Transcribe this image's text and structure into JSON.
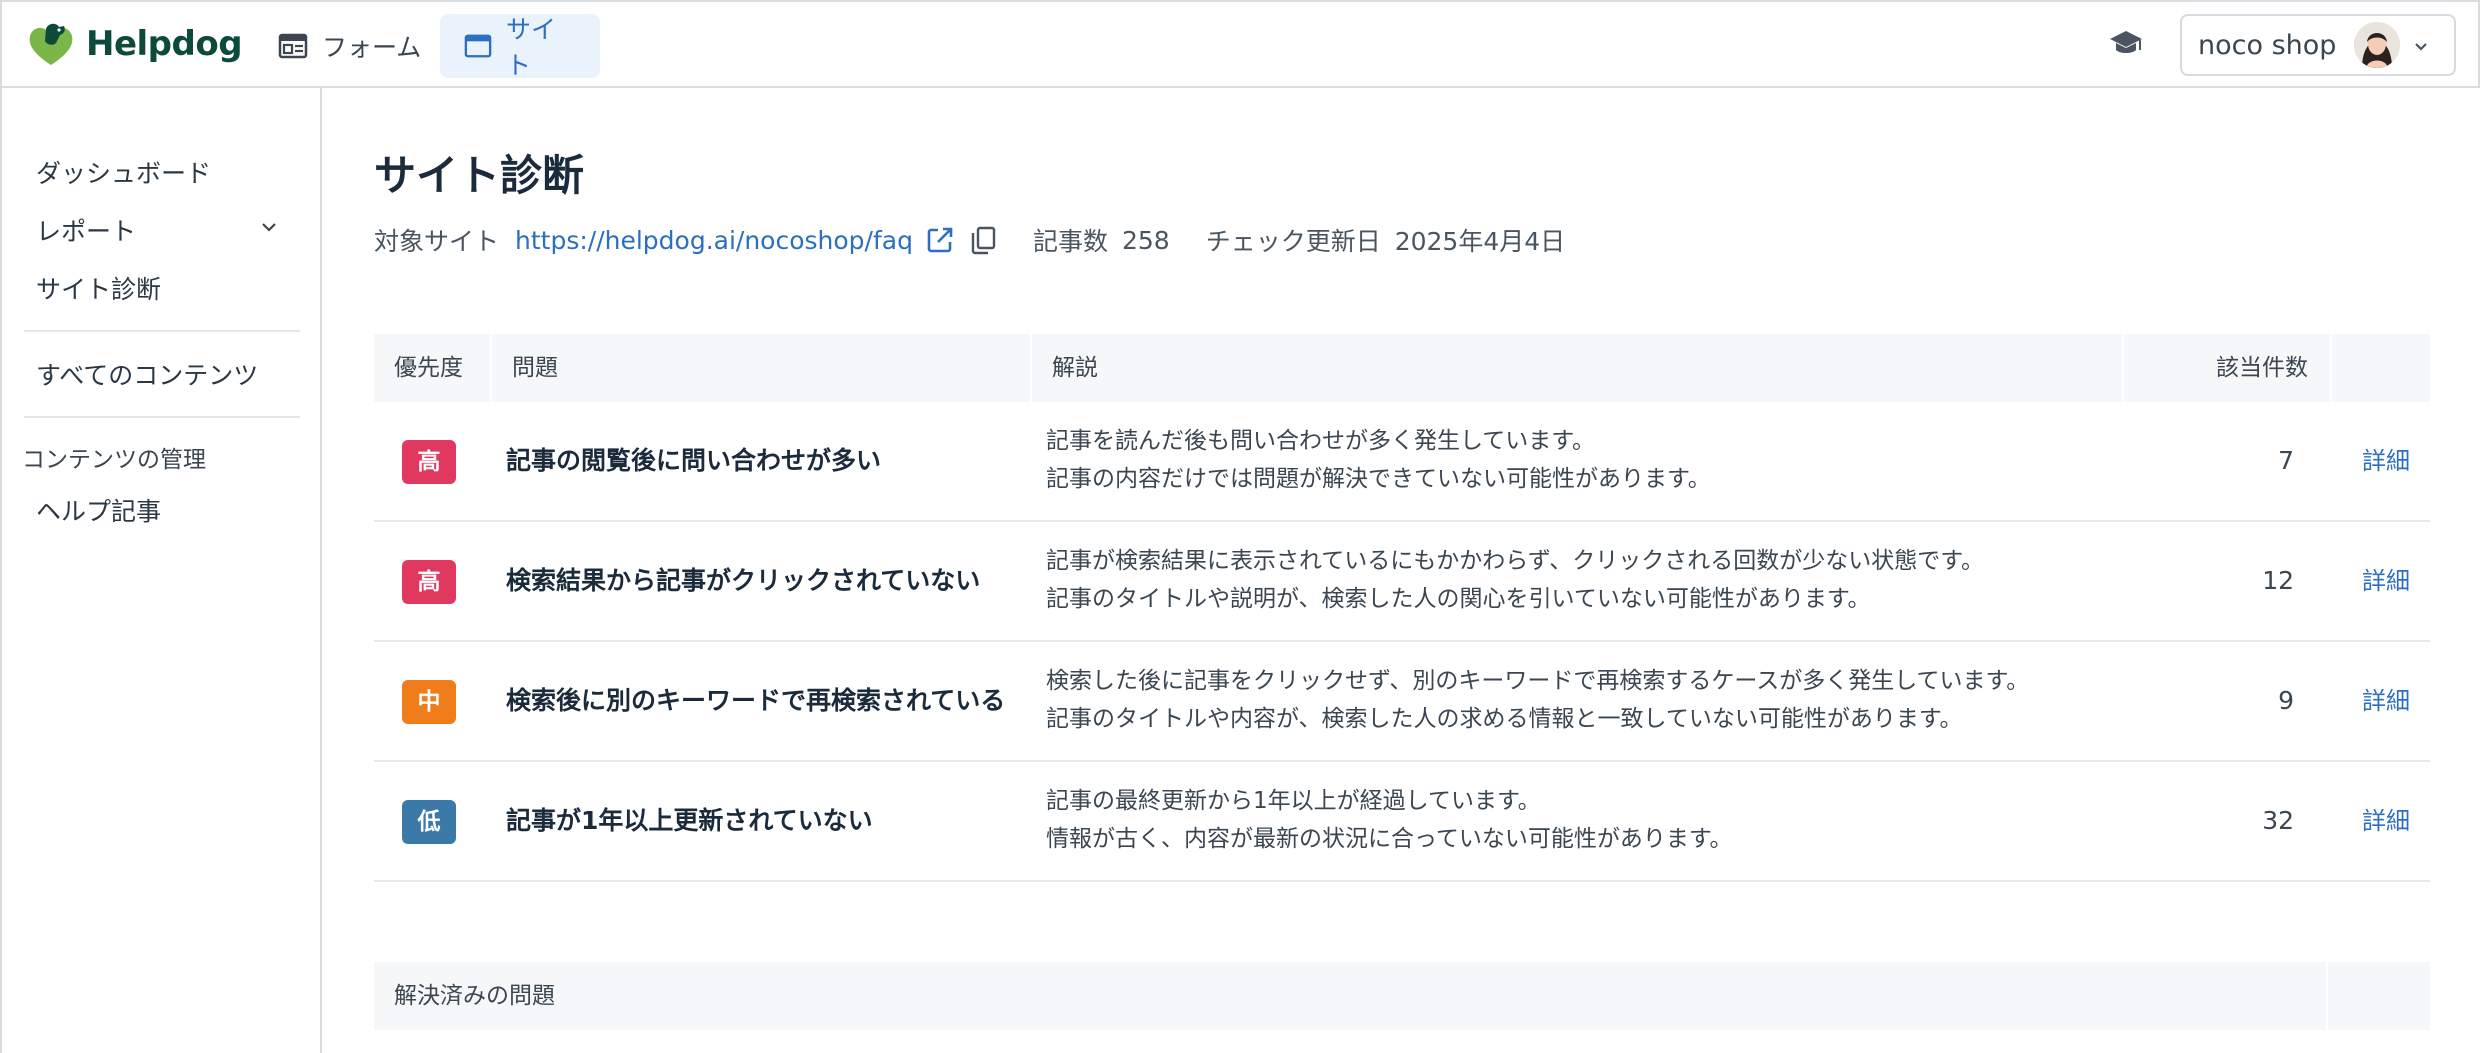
{
  "header": {
    "brand": "Helpdog",
    "nav": [
      {
        "label": "フォーム",
        "icon": "form-icon"
      },
      {
        "label": "サイト",
        "icon": "site-window-icon"
      }
    ],
    "account_name": "noco shop"
  },
  "sidebar": {
    "items": [
      {
        "label": "ダッシュボード"
      },
      {
        "label": "レポート"
      },
      {
        "label": "サイト診断"
      },
      {
        "label": "すべてのコンテンツ"
      }
    ],
    "group_label": "コンテンツの管理",
    "group_items": [
      {
        "label": "ヘルプ記事"
      }
    ]
  },
  "page": {
    "title": "サイト診断",
    "target_label": "対象サイト",
    "target_url": "https://helpdog.ai/nocoshop/faq",
    "article_count_label": "記事数",
    "article_count": "258",
    "check_updated_label": "チェック更新日",
    "check_updated": "2025年4月4日"
  },
  "table": {
    "headers": {
      "priority": "優先度",
      "problem": "問題",
      "explanation": "解説",
      "count": "該当件数"
    },
    "rows": [
      {
        "priority": "高",
        "priority_color": "#e0385f",
        "problem": "記事の閲覧後に問い合わせが多い",
        "line1": "記事を読んだ後も問い合わせが多く発生しています。",
        "line2": "記事の内容だけでは問題が解決できていない可能性があります。",
        "count": "7",
        "detail": "詳細"
      },
      {
        "priority": "高",
        "priority_color": "#e0385f",
        "problem": "検索結果から記事がクリックされていない",
        "line1": "記事が検索結果に表示されているにもかかわらず、クリックされる回数が少ない状態です。",
        "line2": "記事のタイトルや説明が、検索した人の関心を引いていない可能性があります。",
        "count": "12",
        "detail": "詳細"
      },
      {
        "priority": "中",
        "priority_color": "#ef7d1c",
        "problem": "検索後に別のキーワードで再検索されている",
        "line1": "検索した後に記事をクリックせず、別のキーワードで再検索するケースが多く発生しています。",
        "line2": "記事のタイトルや内容が、検索した人の求める情報と一致していない可能性があります。",
        "count": "9",
        "detail": "詳細"
      },
      {
        "priority": "低",
        "priority_color": "#3b7aa8",
        "problem": "記事が1年以上更新されていない",
        "line1": "記事の最終更新から1年以上が経過しています。",
        "line2": "情報が古く、内容が最新の状況に合っていない可能性があります。",
        "count": "32",
        "detail": "詳細"
      }
    ]
  },
  "resolved": {
    "label": "解決済みの問題"
  }
}
